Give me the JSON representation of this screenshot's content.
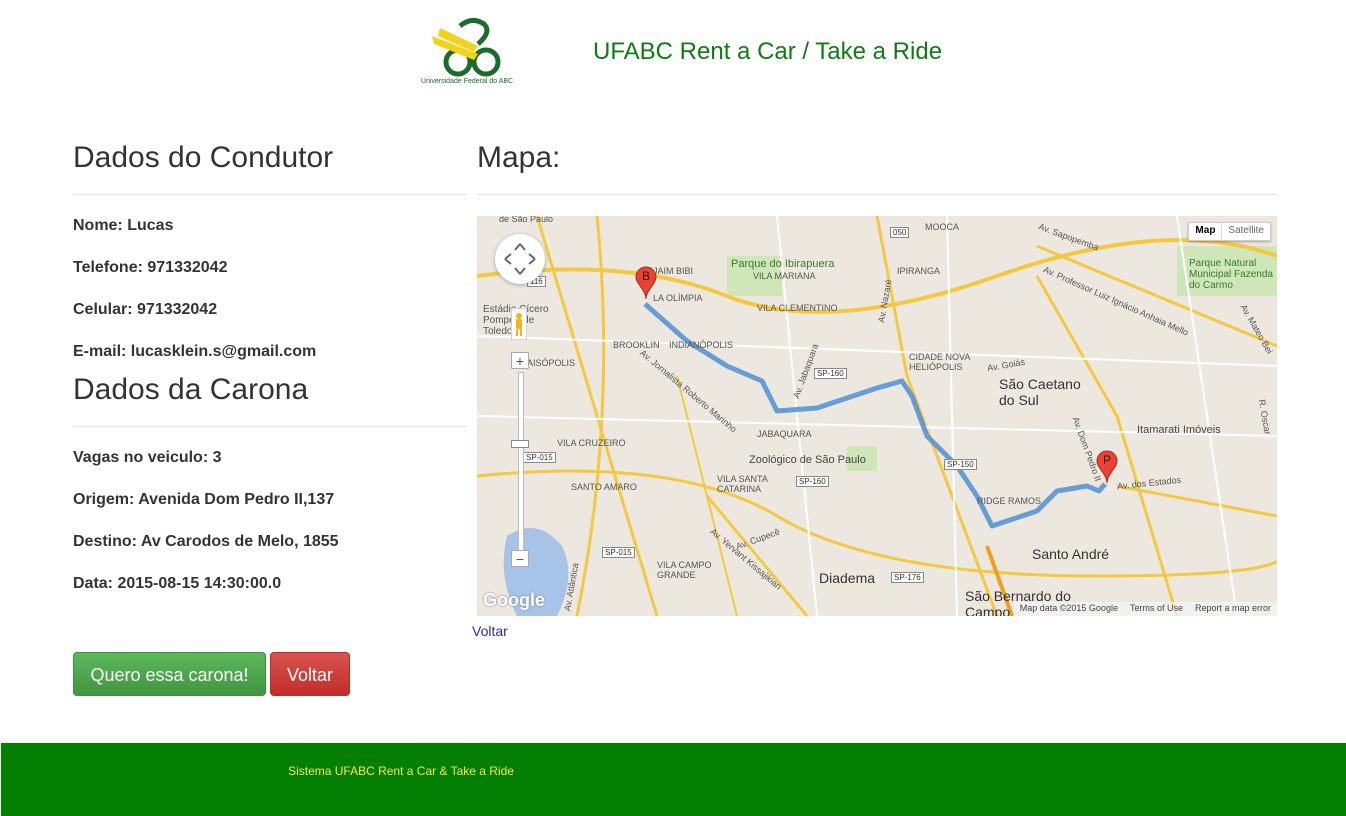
{
  "header": {
    "logo_caption": "Universidade Federal do ABC",
    "title": "UFABC Rent a Car / Take a Ride"
  },
  "driver": {
    "section_title": "Dados do Condutor",
    "name": "Nome: Lucas",
    "phone": "Telefone: 971332042",
    "mobile": "Celular: 971332042",
    "email": "E-mail: lucasklein.s@gmail.com"
  },
  "ride": {
    "section_title": "Dados da Carona",
    "seats": "Vagas no veiculo: 3",
    "origin": "Origem: Avenida Dom Pedro II,137",
    "destination": "Destino: Av Carodos de Melo, 1855",
    "date": "Data: 2015-08-15 14:30:00.0"
  },
  "buttons": {
    "want_ride": "Quero essa carona!",
    "back": "Voltar"
  },
  "map": {
    "section_title": "Mapa:",
    "type_map": "Map",
    "type_satellite": "Satellite",
    "marker_start": "B",
    "marker_end": "P",
    "google_logo": "Google",
    "attribution_data": "Map data ©2015 Google",
    "attribution_terms": "Terms of Use",
    "attribution_report": "Report a map error",
    "labels": {
      "sao_paulo": "de São Paulo",
      "jardim_bibi": "JAIM BIBI",
      "vila_olimpia": "LA OLÍMPIA",
      "parque_ibirapuera": "Parque do Ibirapuera",
      "vila_mariana": "VILA MARIANA",
      "vila_clementino": "VILA CLEMENTINO",
      "ipiranga": "IPIRANGA",
      "mooca": "MOOCA",
      "estadio": "Estádio Cícero Pompeu de Toledo",
      "brooklin": "BROOKLIN",
      "indianopolis": "INDIANÓPOLIS",
      "aisopolis": "AISÓPOLIS",
      "jabaquara": "JABAQUARA",
      "vila_cruzeiro": "VILA CRUZEIRO",
      "zoologico": "Zoológico de São Paulo",
      "vila_santa_catarina": "VILA SANTA CATARINA",
      "santo_amaro": "SANTO AMARO",
      "cidade_nova_heliopolis": "CIDADE NOVA HELIÓPOLIS",
      "sao_caetano": "São Caetano do Sul",
      "itamarati": "Itamarati Imóveis",
      "santo_andre": "Santo André",
      "diadema": "Diadema",
      "sao_bernardo": "São Bernardo do Campo",
      "vila_campo_grande": "VILA CAMPO GRANDE",
      "ridge_ramos": "RIDGE RAMOS",
      "parque_natural": "Parque Natural Municipal Fazenda do Carmo",
      "av_sapopemba": "Av. Sapopemba",
      "av_anhaia_mello": "Av. Professor Luiz Ignácio Anhaia Mello",
      "av_goias": "Av. Goiás",
      "av_dom_pedro": "Av. Dom Pedro II",
      "av_estados": "Av. dos Estados",
      "av_cupece": "Av. Cupecê",
      "av_atlantica": "Av. Atlântica",
      "av_jornalista": "Av. Jornalista Roberto Marinho",
      "av_jabaquara": "Av. Jabaquara",
      "av_nazare": "Av. Nazaré",
      "av_yervant": "Av. Yervant Kissajikian",
      "av_mateo_bei": "Av. Mateo Bei",
      "r_oscar": "R. Oscar",
      "sp160_a": "SP-160",
      "sp160_b": "SP-160",
      "sp150": "SP-150",
      "sp015_a": "SP-015",
      "sp015_b": "SP-015",
      "sp176": "SP-176",
      "br116": "116",
      "r050": "050"
    }
  },
  "link_back": "Voltar",
  "footer": {
    "text": "Sistema UFABC Rent a Car & Take a Ride"
  },
  "colors": {
    "header_title": "#0e7c12",
    "footer_bg": "#038003",
    "footer_text": "#f5e84b",
    "btn_green": "#5cb85c",
    "btn_red": "#d9534f",
    "route": "#4f8fd6"
  }
}
